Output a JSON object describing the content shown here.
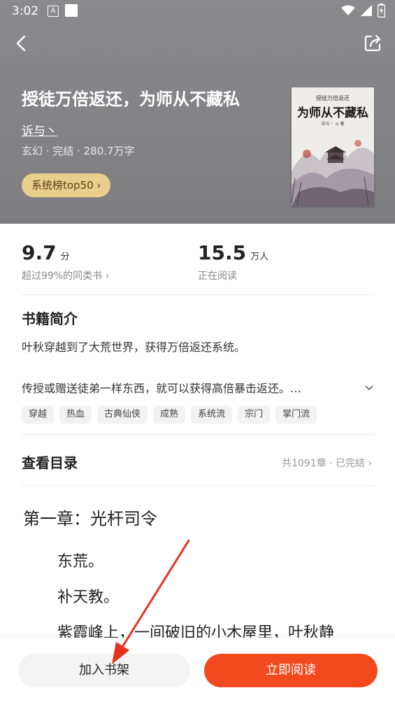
{
  "status_bar": {
    "time": "3:02",
    "a_badge": "A"
  },
  "header": {
    "book_title": "授徒万倍返还，为师从不藏私",
    "author": "诉与丶",
    "meta": "玄幻 · 完结 · 280.7万字",
    "rank_label": "系统榜top50 ›"
  },
  "cover": {
    "series_text": "授徒万倍返还",
    "title_text": "为师从不藏私",
    "author_text": "诉与丶 ◎ 著"
  },
  "stats": {
    "score": "9.7",
    "score_unit": "分",
    "score_sub": "超过99%的同类书 ›",
    "readers": "15.5",
    "readers_unit": "万人",
    "readers_sub": "正在阅读"
  },
  "intro": {
    "title": "书籍简介",
    "line1": "叶秋穿越到了大荒世界，获得万倍返还系统。",
    "line2": "传授或赠送徒弟一样东西，就可以获得高倍暴击返还。…",
    "tags": [
      "穿越",
      "热血",
      "古典仙侠",
      "成熟",
      "系统流",
      "宗门",
      "掌门流"
    ]
  },
  "toc": {
    "title": "查看目录",
    "info": "共1091章 · 已完结 ›"
  },
  "preview": {
    "chapter_title": "第一章：光杆司令",
    "paragraphs": [
      "东荒。",
      "补天教。",
      "紫霞峰上，一间破旧的小木屋里，叶秋静"
    ]
  },
  "buttons": {
    "add_shelf": "加入书架",
    "read_now": "立即阅读"
  },
  "colors": {
    "hero_bg": "#8a8a8c",
    "rank_pill": "#e8cf8e",
    "primary": "#f24a1e",
    "annotation_arrow": "#e8321f"
  }
}
